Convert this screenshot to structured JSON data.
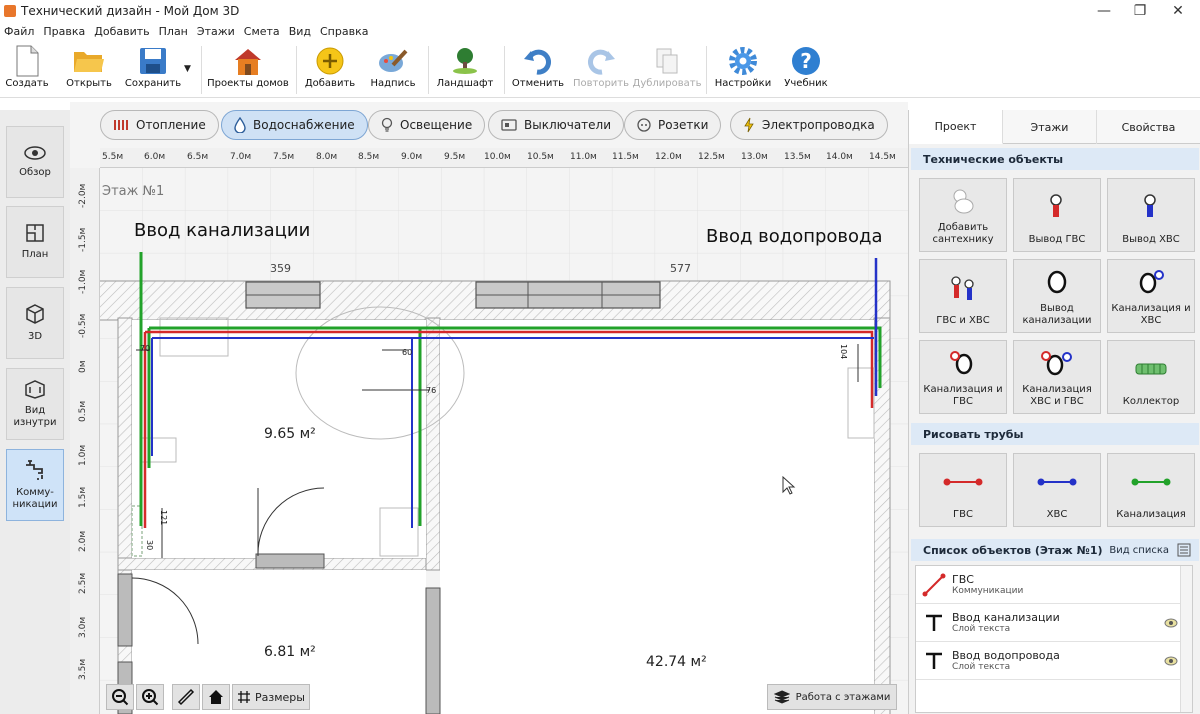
{
  "window": {
    "title": "Технический дизайн - Мой Дом 3D",
    "min": "—",
    "max": "❐",
    "close": "✕"
  },
  "menu": [
    "Файл",
    "Правка",
    "Добавить",
    "План",
    "Этажи",
    "Смета",
    "Вид",
    "Справка"
  ],
  "toolbar": {
    "create": "Создать",
    "open": "Открыть",
    "save": "Сохранить",
    "projects": "Проекты домов",
    "add": "Добавить",
    "label": "Надпись",
    "landscape": "Ландшафт",
    "undo": "Отменить",
    "redo": "Повторить",
    "duplicate": "Дублировать",
    "settings": "Настройки",
    "tutorial": "Учебник"
  },
  "leftnav": {
    "overview": "Обзор",
    "plan": "План",
    "view3d": "3D",
    "inside1": "Вид",
    "inside2": "изнутри",
    "comm1": "Комму-",
    "comm2": "никации"
  },
  "tabs": {
    "heating": "Отопление",
    "water": "Водоснабжение",
    "lighting": "Освещение",
    "switches": "Выключатели",
    "sockets": "Розетки",
    "wiring": "Электропроводка"
  },
  "ruler": {
    "h": [
      "5.5м",
      "6.0м",
      "6.5м",
      "7.0м",
      "7.5м",
      "8.0м",
      "8.5м",
      "9.0м",
      "9.5м",
      "10.0м",
      "10.5м",
      "11.0м",
      "11.5м",
      "12.0м",
      "12.5м",
      "13.0м",
      "13.5м",
      "14.0м",
      "14.5м"
    ],
    "v": [
      "-2.0м",
      "-1.5м",
      "-1.0м",
      "-0.5м",
      "0м",
      "0.5м",
      "1.0м",
      "1.5м",
      "2.0м",
      "2.5м",
      "3.0м",
      "3.5м"
    ]
  },
  "plan": {
    "floor": "Этаж №1",
    "sewer_in": "Ввод канализации",
    "water_in": "Ввод водопровода",
    "dim_359": "359",
    "dim_577": "577",
    "area1": "9.65 м²",
    "area2": "6.81 м²",
    "area3": "42.74 м²",
    "d70": "70",
    "d60": "60",
    "d76": "76",
    "d104": "104",
    "d121": "121",
    "d30": "30"
  },
  "canvas_ctrl": {
    "sizes": "Размеры",
    "floors": "Работа с этажами"
  },
  "right": {
    "tabs": {
      "project": "Проект",
      "floors": "Этажи",
      "props": "Свойства"
    },
    "tech_header": "Технические объекты",
    "tiles": {
      "t1": "Добавить сантехнику",
      "t2": "Вывод ГВС",
      "t3": "Вывод ХВС",
      "t4": "ГВС и ХВС",
      "t5": "Вывод канализации",
      "t6": "Канализация и ХВС",
      "t7": "Канализация и ГВС",
      "t8": "Канализация ХВС и ГВС",
      "t9": "Коллектор"
    },
    "pipes_header": "Рисовать трубы",
    "pipes": {
      "hot": "ГВС",
      "cold": "ХВС",
      "sewer": "Канализация"
    },
    "list_header": "Список объектов (Этаж №1)",
    "list_view": "Вид списка",
    "objects": [
      {
        "name": "ГВС",
        "sub": "Коммуникации"
      },
      {
        "name": "Ввод канализации",
        "sub": "Слой текста"
      },
      {
        "name": "Ввод водопровода",
        "sub": "Слой текста"
      }
    ]
  },
  "colors": {
    "hot": "#d42a2a",
    "cold": "#2432c8",
    "sewer": "#22a22a",
    "accent": "#cfe1f5"
  }
}
